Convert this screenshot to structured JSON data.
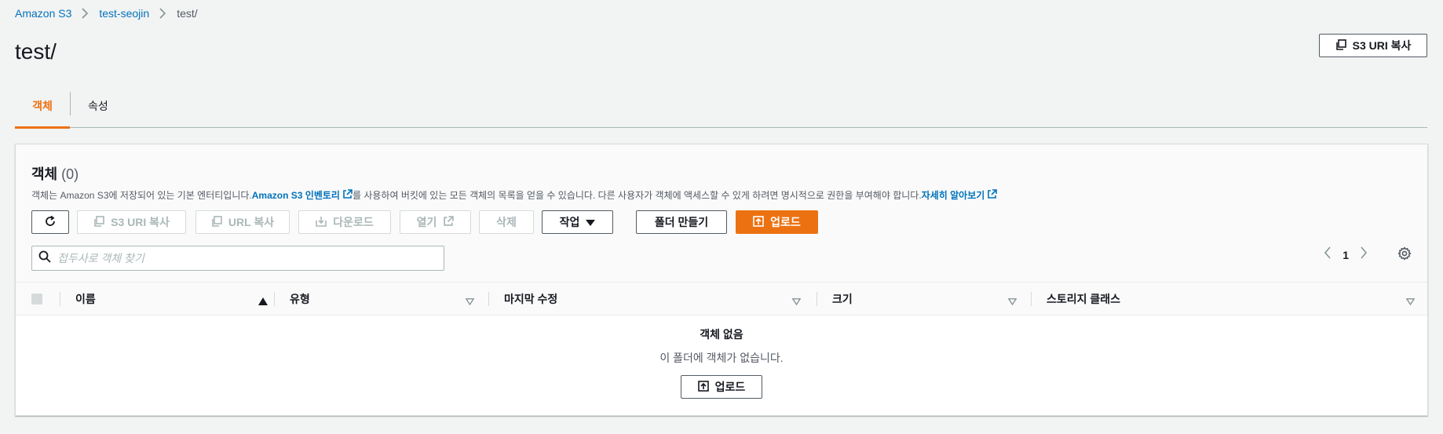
{
  "breadcrumb": {
    "items": [
      "Amazon S3",
      "test-seojin"
    ],
    "current": "test/"
  },
  "page": {
    "title": "test/",
    "copy_uri_label": "S3 URI 복사"
  },
  "tabs": [
    {
      "label": "객체",
      "active": true
    },
    {
      "label": "속성",
      "active": false
    }
  ],
  "objects": {
    "title": "객체",
    "count": "(0)",
    "desc_before": "객체는 Amazon S3에 저장되어 있는 기본 엔터티입니다. ",
    "desc_link1": "Amazon S3 인벤토리",
    "desc_middle": "를 사용하여 버킷에 있는 모든 객체의 목록을 얻을 수 있습니다. 다른 사용자가 객체에 액세스할 수 있게 하려면 명시적으로 권한을 부여해야 합니다. ",
    "desc_link2": "자세히 알아보기"
  },
  "toolbar": {
    "copy_s3_uri": "S3 URI 복사",
    "copy_url": "URL 복사",
    "download": "다운로드",
    "open": "열기",
    "delete": "삭제",
    "actions": "작업",
    "create_folder": "폴더 만들기",
    "upload": "업로드"
  },
  "search": {
    "placeholder": "접두사로 객체 찾기"
  },
  "pagination": {
    "current_page": "1"
  },
  "table": {
    "columns": [
      "이름",
      "유형",
      "마지막 수정",
      "크기",
      "스토리지 클래스"
    ]
  },
  "empty": {
    "title": "객체 없음",
    "subtitle": "이 폴더에 객체가 없습니다.",
    "upload_label": "업로드"
  },
  "colors": {
    "accent": "#ec7211",
    "link": "#0073bb",
    "text": "#16191f",
    "muted": "#545b64",
    "disabled": "#aab7b8"
  }
}
